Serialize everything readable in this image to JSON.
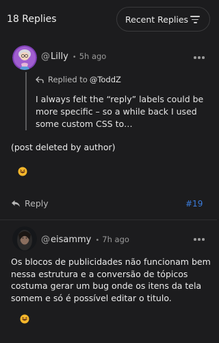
{
  "header": {
    "replies_count": "18 Replies",
    "sort_label": "Recent Replies",
    "sort_icon": "filter-lines-icon"
  },
  "posts": [
    {
      "username": "Lilly",
      "at": "@",
      "time": "5h ago",
      "reply_to": {
        "label": "Replied to",
        "target": "@ToddZ"
      },
      "quote": "I always felt the “reply” labels could be more specific – so a while back I used some custom CSS to…",
      "body": "(post deleted by author)",
      "reply_label": "Reply",
      "post_number": "#19"
    },
    {
      "username": "eisammy",
      "at": "@",
      "time": "7h ago",
      "body": "Os blocos de publicidades não funcionam bem nessa estrutura e a conversão de tópicos costuma gerar um bug onde os itens da tela somem e só é possível editar o titulo."
    }
  ],
  "colors": {
    "background": "#1c1c1e",
    "link": "#3b7dde",
    "divider": "#2e2e30"
  }
}
